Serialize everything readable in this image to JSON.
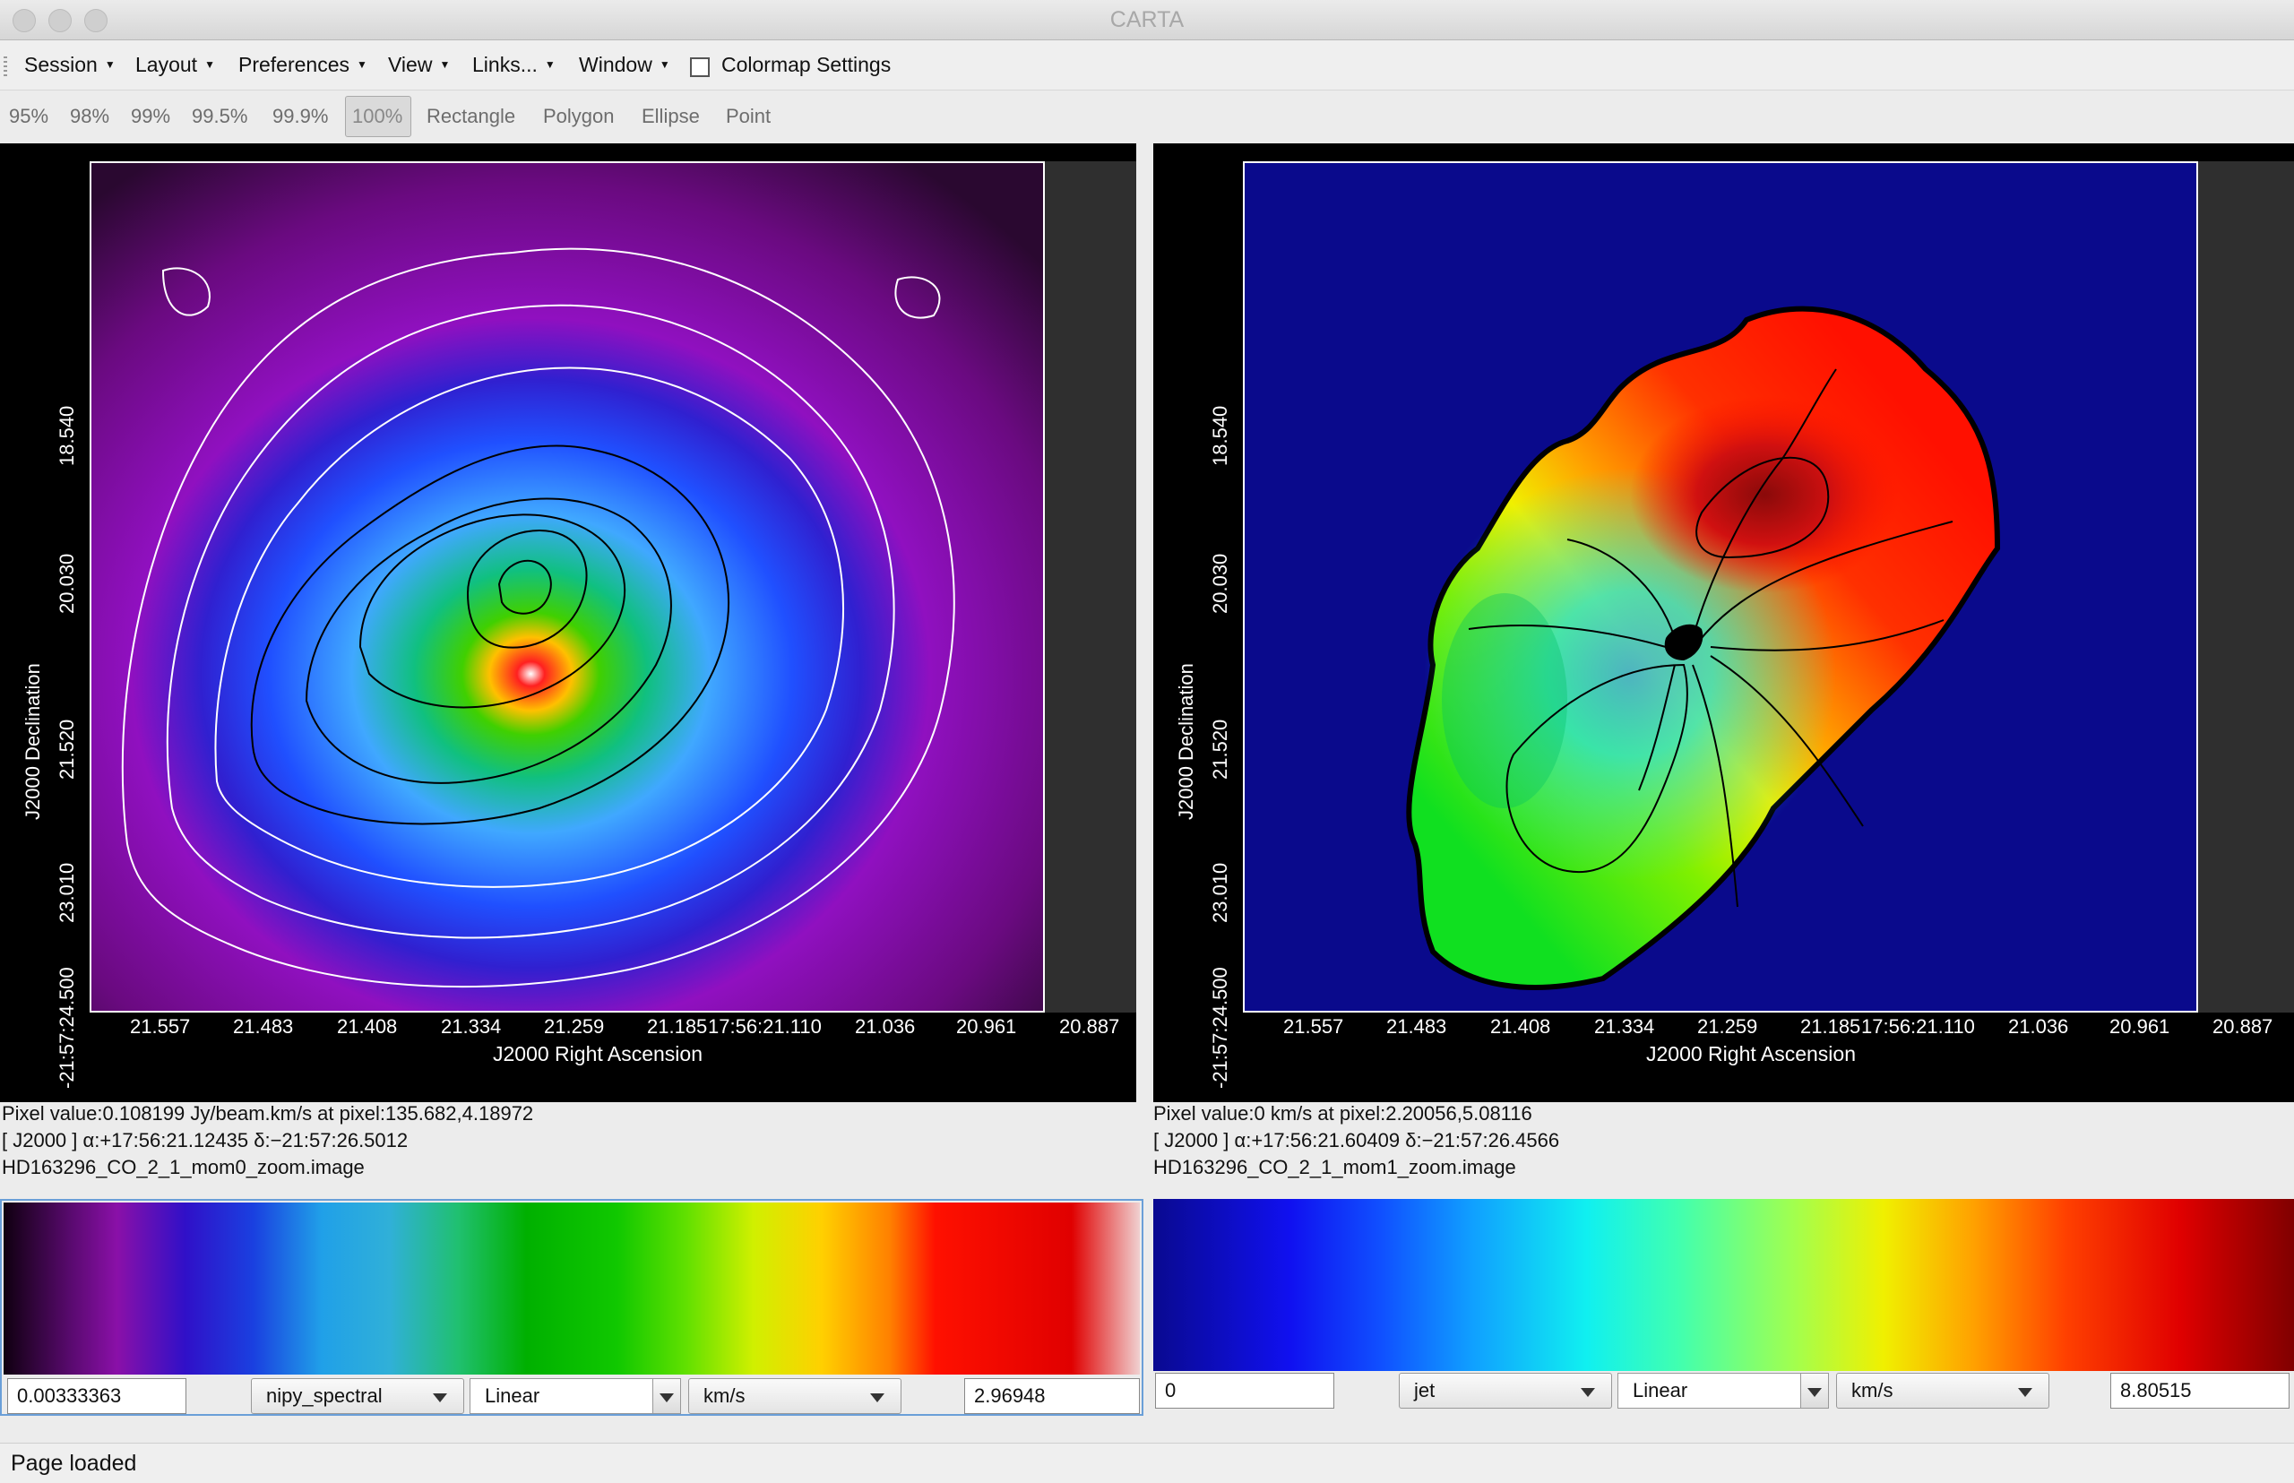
{
  "window": {
    "title": "CARTA"
  },
  "menubar": {
    "items": [
      "Session",
      "Layout",
      "Preferences",
      "View",
      "Links...",
      "Window"
    ],
    "colormap_settings_label": "Colormap Settings",
    "colormap_settings_checked": false
  },
  "toolbar": {
    "clip_buttons": [
      "95%",
      "98%",
      "99%",
      "99.5%",
      "99.9%",
      "100%"
    ],
    "selected_clip": "100%",
    "region_buttons": [
      "Rectangle",
      "Polygon",
      "Ellipse",
      "Point"
    ]
  },
  "left_panel": {
    "x_ticks": [
      "21.557",
      "21.483",
      "21.408",
      "21.334",
      "21.259",
      "21.185",
      "17:56:21.110",
      "21.036",
      "20.961",
      "20.887"
    ],
    "y_ticks": [
      "18.540",
      "20.030",
      "21.520",
      "23.010",
      "-21:57:24.500"
    ],
    "x_axis_title": "J2000 Right Ascension",
    "y_axis_title": "J2000 Declination",
    "pixel_value": "Pixel value:0.108199 Jy/beam.km/s at pixel:135.682,4.18972",
    "coords": "[ J2000 ] α:+17:56:21.12435 δ:−21:57:26.5012",
    "filename": "HD163296_CO_2_1_mom0_zoom.image",
    "colormap": {
      "min": "0.00333363",
      "map": "nipy_spectral",
      "scale": "Linear",
      "unit": "km/s",
      "max": "2.96948"
    }
  },
  "right_panel": {
    "x_ticks": [
      "21.557",
      "21.483",
      "21.408",
      "21.334",
      "21.259",
      "21.185",
      "17:56:21.110",
      "21.036",
      "20.961",
      "20.887"
    ],
    "y_ticks": [
      "18.540",
      "20.030",
      "21.520",
      "23.010",
      "-21:57:24.500"
    ],
    "x_axis_title": "J2000 Right Ascension",
    "y_axis_title": "J2000 Declination",
    "pixel_value": "Pixel value:0 km/s at pixel:2.20056,5.08116",
    "coords": "[ J2000 ] α:+17:56:21.60409 δ:−21:57:26.4566",
    "filename": "HD163296_CO_2_1_mom1_zoom.image",
    "colormap": {
      "min": "0",
      "map": "jet",
      "scale": "Linear",
      "unit": "km/s",
      "max": "8.80515"
    }
  },
  "status": {
    "text": "Page loaded"
  },
  "colors": {
    "mom1_background": "#0a0a8c",
    "panel_background": "#000000"
  }
}
